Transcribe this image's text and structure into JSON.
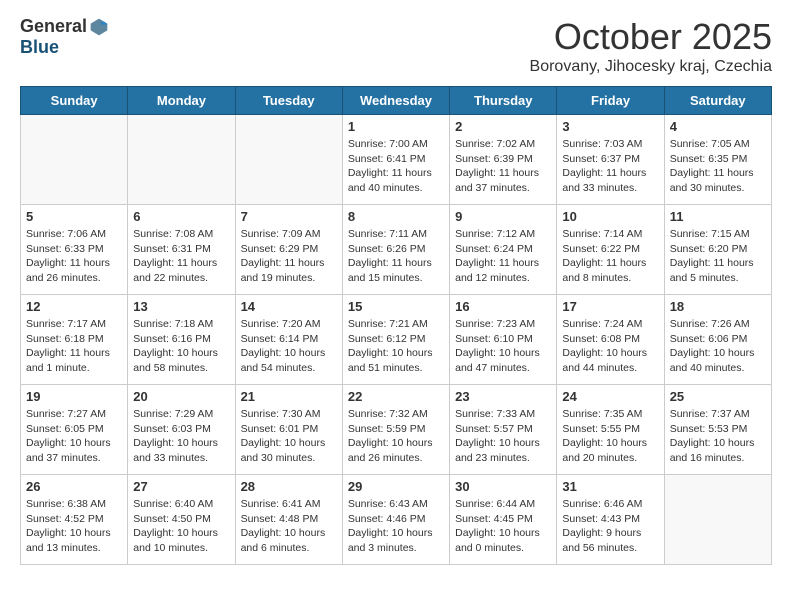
{
  "header": {
    "logo_general": "General",
    "logo_blue": "Blue",
    "title": "October 2025",
    "subtitle": "Borovany, Jihocesky kraj, Czechia"
  },
  "weekdays": [
    "Sunday",
    "Monday",
    "Tuesday",
    "Wednesday",
    "Thursday",
    "Friday",
    "Saturday"
  ],
  "weeks": [
    [
      {
        "day": "",
        "info": ""
      },
      {
        "day": "",
        "info": ""
      },
      {
        "day": "",
        "info": ""
      },
      {
        "day": "1",
        "info": "Sunrise: 7:00 AM\nSunset: 6:41 PM\nDaylight: 11 hours and 40 minutes."
      },
      {
        "day": "2",
        "info": "Sunrise: 7:02 AM\nSunset: 6:39 PM\nDaylight: 11 hours and 37 minutes."
      },
      {
        "day": "3",
        "info": "Sunrise: 7:03 AM\nSunset: 6:37 PM\nDaylight: 11 hours and 33 minutes."
      },
      {
        "day": "4",
        "info": "Sunrise: 7:05 AM\nSunset: 6:35 PM\nDaylight: 11 hours and 30 minutes."
      }
    ],
    [
      {
        "day": "5",
        "info": "Sunrise: 7:06 AM\nSunset: 6:33 PM\nDaylight: 11 hours and 26 minutes."
      },
      {
        "day": "6",
        "info": "Sunrise: 7:08 AM\nSunset: 6:31 PM\nDaylight: 11 hours and 22 minutes."
      },
      {
        "day": "7",
        "info": "Sunrise: 7:09 AM\nSunset: 6:29 PM\nDaylight: 11 hours and 19 minutes."
      },
      {
        "day": "8",
        "info": "Sunrise: 7:11 AM\nSunset: 6:26 PM\nDaylight: 11 hours and 15 minutes."
      },
      {
        "day": "9",
        "info": "Sunrise: 7:12 AM\nSunset: 6:24 PM\nDaylight: 11 hours and 12 minutes."
      },
      {
        "day": "10",
        "info": "Sunrise: 7:14 AM\nSunset: 6:22 PM\nDaylight: 11 hours and 8 minutes."
      },
      {
        "day": "11",
        "info": "Sunrise: 7:15 AM\nSunset: 6:20 PM\nDaylight: 11 hours and 5 minutes."
      }
    ],
    [
      {
        "day": "12",
        "info": "Sunrise: 7:17 AM\nSunset: 6:18 PM\nDaylight: 11 hours and 1 minute."
      },
      {
        "day": "13",
        "info": "Sunrise: 7:18 AM\nSunset: 6:16 PM\nDaylight: 10 hours and 58 minutes."
      },
      {
        "day": "14",
        "info": "Sunrise: 7:20 AM\nSunset: 6:14 PM\nDaylight: 10 hours and 54 minutes."
      },
      {
        "day": "15",
        "info": "Sunrise: 7:21 AM\nSunset: 6:12 PM\nDaylight: 10 hours and 51 minutes."
      },
      {
        "day": "16",
        "info": "Sunrise: 7:23 AM\nSunset: 6:10 PM\nDaylight: 10 hours and 47 minutes."
      },
      {
        "day": "17",
        "info": "Sunrise: 7:24 AM\nSunset: 6:08 PM\nDaylight: 10 hours and 44 minutes."
      },
      {
        "day": "18",
        "info": "Sunrise: 7:26 AM\nSunset: 6:06 PM\nDaylight: 10 hours and 40 minutes."
      }
    ],
    [
      {
        "day": "19",
        "info": "Sunrise: 7:27 AM\nSunset: 6:05 PM\nDaylight: 10 hours and 37 minutes."
      },
      {
        "day": "20",
        "info": "Sunrise: 7:29 AM\nSunset: 6:03 PM\nDaylight: 10 hours and 33 minutes."
      },
      {
        "day": "21",
        "info": "Sunrise: 7:30 AM\nSunset: 6:01 PM\nDaylight: 10 hours and 30 minutes."
      },
      {
        "day": "22",
        "info": "Sunrise: 7:32 AM\nSunset: 5:59 PM\nDaylight: 10 hours and 26 minutes."
      },
      {
        "day": "23",
        "info": "Sunrise: 7:33 AM\nSunset: 5:57 PM\nDaylight: 10 hours and 23 minutes."
      },
      {
        "day": "24",
        "info": "Sunrise: 7:35 AM\nSunset: 5:55 PM\nDaylight: 10 hours and 20 minutes."
      },
      {
        "day": "25",
        "info": "Sunrise: 7:37 AM\nSunset: 5:53 PM\nDaylight: 10 hours and 16 minutes."
      }
    ],
    [
      {
        "day": "26",
        "info": "Sunrise: 6:38 AM\nSunset: 4:52 PM\nDaylight: 10 hours and 13 minutes."
      },
      {
        "day": "27",
        "info": "Sunrise: 6:40 AM\nSunset: 4:50 PM\nDaylight: 10 hours and 10 minutes."
      },
      {
        "day": "28",
        "info": "Sunrise: 6:41 AM\nSunset: 4:48 PM\nDaylight: 10 hours and 6 minutes."
      },
      {
        "day": "29",
        "info": "Sunrise: 6:43 AM\nSunset: 4:46 PM\nDaylight: 10 hours and 3 minutes."
      },
      {
        "day": "30",
        "info": "Sunrise: 6:44 AM\nSunset: 4:45 PM\nDaylight: 10 hours and 0 minutes."
      },
      {
        "day": "31",
        "info": "Sunrise: 6:46 AM\nSunset: 4:43 PM\nDaylight: 9 hours and 56 minutes."
      },
      {
        "day": "",
        "info": ""
      }
    ]
  ]
}
